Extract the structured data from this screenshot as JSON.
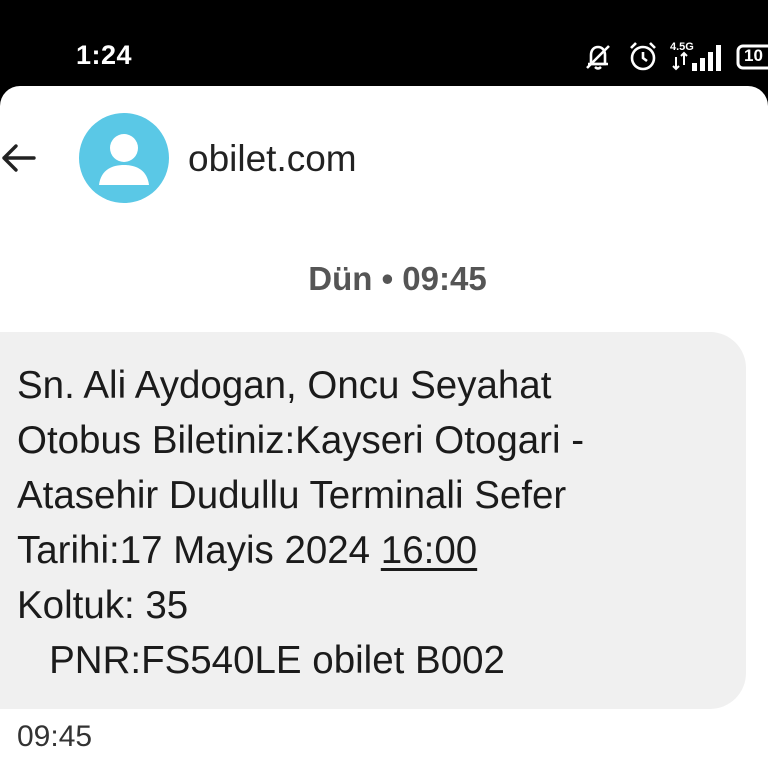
{
  "status_bar": {
    "time": "1:24",
    "network": "4.5G",
    "battery": "10",
    "icons": [
      "mute-icon",
      "alarm-icon",
      "signal-icon",
      "battery-icon"
    ]
  },
  "header": {
    "back_icon": "back-arrow-icon",
    "avatar_icon": "person-icon",
    "contact_name": "obilet.com",
    "avatar_color": "#5ac8e6"
  },
  "conversation": {
    "date_separator": "Dün • 09:45",
    "message": {
      "before_link": "Sn. Ali Aydogan, Oncu Seyahat\nOtobus Biletiniz:Kayseri Otogari -\nAtasehir Dudullu Terminali Sefer\nTarihi:17 Mayis 2024 ",
      "link_text": "16:00",
      "after_link": "\nKoltuk: 35\n   PNR:FS540LE obilet B002",
      "time": "09:45"
    }
  }
}
